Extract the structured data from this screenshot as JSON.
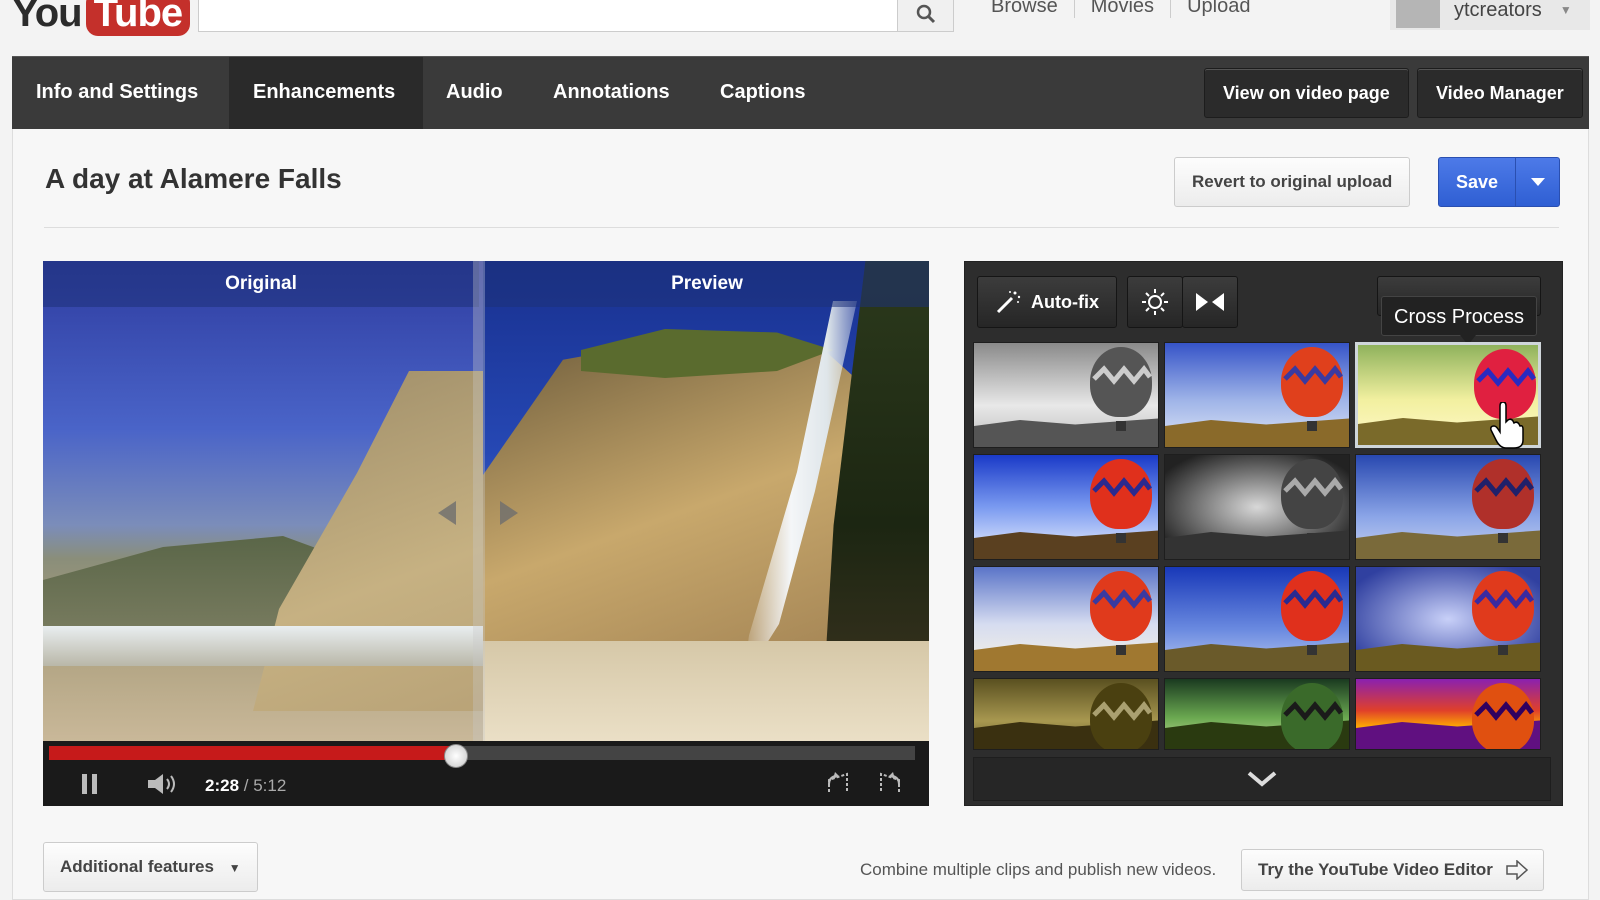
{
  "masthead": {
    "logo_you": "You",
    "logo_tube": "Tube",
    "search_placeholder": "",
    "nav": [
      "Browse",
      "Movies",
      "Upload"
    ],
    "username": "ytcreators"
  },
  "tabs": [
    {
      "label": "Info and Settings",
      "active": false
    },
    {
      "label": "Enhancements",
      "active": true
    },
    {
      "label": "Audio",
      "active": false
    },
    {
      "label": "Annotations",
      "active": false
    },
    {
      "label": "Captions",
      "active": false
    }
  ],
  "header_buttons": {
    "view_on_page": "View on video page",
    "video_manager": "Video Manager"
  },
  "video": {
    "title": "A day at Alamere Falls",
    "revert_label": "Revert to original upload",
    "save_label": "Save"
  },
  "player": {
    "original_label": "Original",
    "preview_label": "Preview",
    "current_time": "2:28",
    "separator": " / ",
    "duration": "5:12",
    "progress": 0.47
  },
  "effects": {
    "autofix_label": "Auto-fix",
    "tooltip": "Cross Process",
    "selected_index": 2,
    "filters": [
      {
        "palette": "bw"
      },
      {
        "palette": "blue"
      },
      {
        "palette": "cross"
      },
      {
        "palette": "vivid"
      },
      {
        "palette": "bw-dark"
      },
      {
        "palette": "cartoon"
      },
      {
        "palette": "warm"
      },
      {
        "palette": "cool"
      },
      {
        "palette": "lomo"
      },
      {
        "palette": "sepia"
      },
      {
        "palette": "green"
      },
      {
        "palette": "purple"
      }
    ]
  },
  "footer": {
    "additional_features": "Additional features",
    "hint": "Combine multiple clips and publish new videos.",
    "editor_link": "Try the YouTube Video Editor"
  },
  "colors": {
    "accent_blue": "#3a6ae0",
    "progress_red": "#c61a1a",
    "logo_red": "#c4302b"
  }
}
